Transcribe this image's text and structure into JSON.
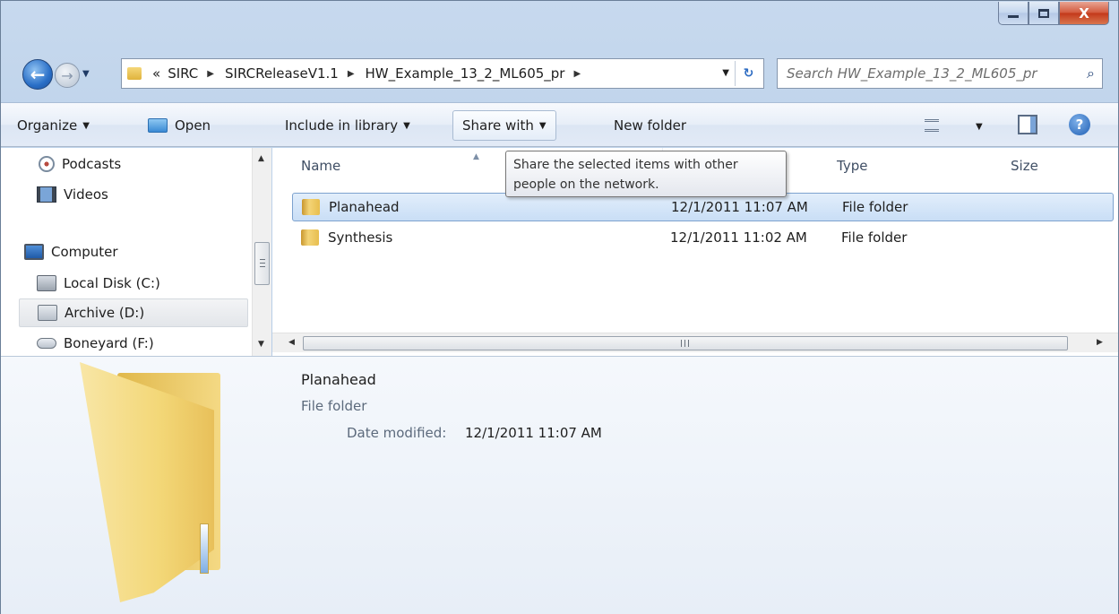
{
  "window": {
    "minimize": "–",
    "maximize": "□",
    "close": "X"
  },
  "address": {
    "overflow": "«",
    "crumbs": [
      "SIRC",
      "SIRCReleaseV1.1",
      "HW_Example_13_2_ML605_pr"
    ],
    "refresh_glyph": "↻"
  },
  "search": {
    "placeholder": "Search HW_Example_13_2_ML605_pr"
  },
  "toolbar": {
    "organize": "Organize",
    "open": "Open",
    "include_in_library": "Include in library",
    "share_with": "Share with",
    "new_folder": "New folder",
    "help": "?"
  },
  "tooltip": {
    "text": "Share the selected items with other people on the network."
  },
  "nav": {
    "podcasts": "Podcasts",
    "videos": "Videos",
    "computer": "Computer",
    "local_disk": "Local Disk (C:)",
    "archive": "Archive (D:)",
    "boneyard": "Boneyard (F:)"
  },
  "columns": {
    "name": "Name",
    "type": "Type",
    "size": "Size"
  },
  "files": [
    {
      "name": "Planahead",
      "date": "12/1/2011 11:07 AM",
      "type": "File folder"
    },
    {
      "name": "Synthesis",
      "date": "12/1/2011 11:02 AM",
      "type": "File folder"
    }
  ],
  "details": {
    "name": "Planahead",
    "type": "File folder",
    "date_label": "Date modified:",
    "date_value": "12/1/2011 11:07 AM"
  },
  "scrollbar": {
    "grip": "III"
  }
}
